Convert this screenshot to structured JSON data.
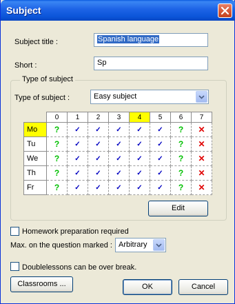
{
  "window": {
    "title": "Subject"
  },
  "fields": {
    "subject_title_label": "Subject title :",
    "subject_title_value": "Spanish language",
    "short_label": "Short :",
    "short_value": "Sp"
  },
  "group": {
    "caption": "Type of subject",
    "type_label": "Type of subject :",
    "type_value": "Easy subject",
    "highlight_color": "#ffff00"
  },
  "timetable": {
    "periods": [
      "0",
      "1",
      "2",
      "3",
      "4",
      "5",
      "6",
      "7"
    ],
    "highlighted_period": "4",
    "legend_symbols": {
      "yes": "✓",
      "maybe": "?",
      "no": "✕"
    },
    "days": [
      {
        "label": "Mo",
        "highlighted": true,
        "cells": [
          "maybe",
          "yes",
          "yes",
          "yes",
          "yes",
          "yes",
          "maybe",
          "no"
        ]
      },
      {
        "label": "Tu",
        "highlighted": false,
        "cells": [
          "maybe",
          "yes",
          "yes",
          "yes",
          "yes",
          "yes",
          "maybe",
          "no"
        ]
      },
      {
        "label": "We",
        "highlighted": false,
        "cells": [
          "maybe",
          "yes",
          "yes",
          "yes",
          "yes",
          "yes",
          "maybe",
          "no"
        ]
      },
      {
        "label": "Th",
        "highlighted": false,
        "cells": [
          "maybe",
          "yes",
          "yes",
          "yes",
          "yes",
          "yes",
          "maybe",
          "no"
        ]
      },
      {
        "label": "Fr",
        "highlighted": false,
        "cells": [
          "maybe",
          "yes",
          "yes",
          "yes",
          "yes",
          "yes",
          "maybe",
          "no"
        ]
      }
    ]
  },
  "buttons": {
    "edit": "Edit",
    "classrooms": "Classrooms ...",
    "ok": "OK",
    "cancel": "Cancel"
  },
  "options": {
    "homework_label": "Homework preparation required",
    "homework_checked": false,
    "max_label": "Max. on the question marked :",
    "max_value": "Arbitrary",
    "doublelessons_label": "Doublelessons can be over break.",
    "doublelessons_checked": false
  }
}
